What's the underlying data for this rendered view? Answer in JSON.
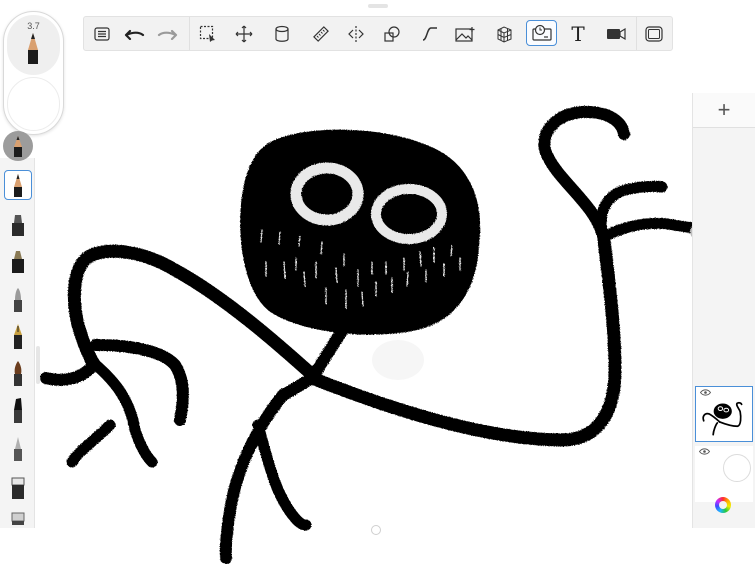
{
  "app": {
    "canvas_bg": "#ffffff",
    "accent": "#4a8fd8",
    "ink": "#000000"
  },
  "toolbar": {
    "tools": [
      {
        "name": "layer-list-icon"
      },
      {
        "name": "undo-icon"
      },
      {
        "name": "redo-icon"
      },
      {
        "name": "selection-icon"
      },
      {
        "name": "transform-icon"
      },
      {
        "name": "fill-icon"
      },
      {
        "name": "ruler-icon"
      },
      {
        "name": "symmetry-icon"
      },
      {
        "name": "shapes-icon"
      },
      {
        "name": "curve-icon"
      },
      {
        "name": "image-import-icon"
      },
      {
        "name": "perspective-icon"
      },
      {
        "name": "time-lapse-icon",
        "active": true
      },
      {
        "name": "text-icon",
        "glyph": "T"
      },
      {
        "name": "video-icon"
      },
      {
        "name": "fullscreen-icon"
      }
    ]
  },
  "brush_puck": {
    "size_value": "3.7"
  },
  "brushes": [
    "pencil-brush",
    "marker-brush",
    "felt-pen-brush",
    "airbrush-brush",
    "ink-pen-brush",
    "paint-brush",
    "chisel-brush",
    "smudge-brush",
    "eraser-brush",
    "soft-eraser-brush"
  ],
  "layers": {
    "add_label": "+",
    "items": [
      {
        "name": "layer-1",
        "visible": true,
        "active": true
      },
      {
        "name": "layer-2",
        "visible": true,
        "active": false
      }
    ]
  }
}
